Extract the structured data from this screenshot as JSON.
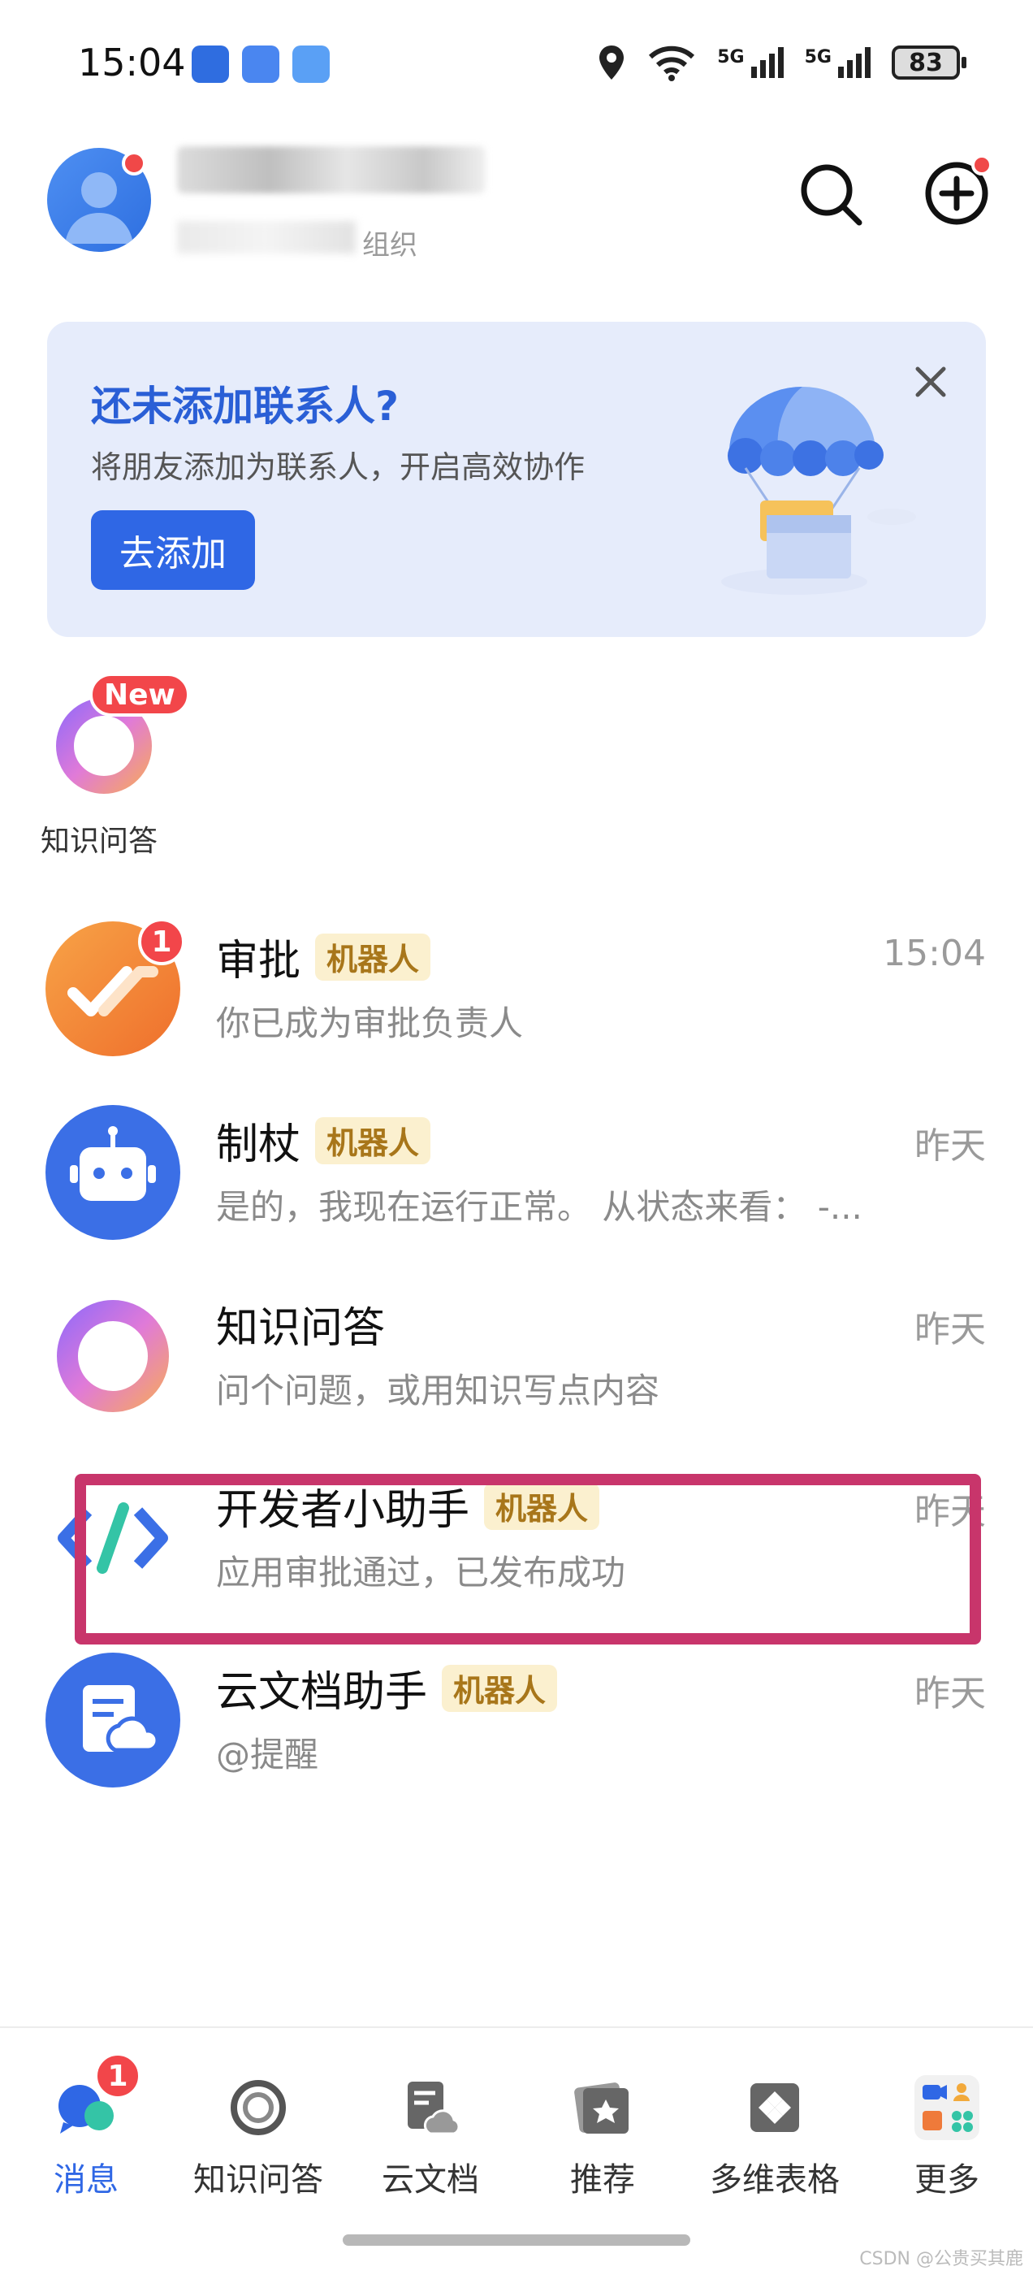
{
  "status_bar": {
    "time": "15:04",
    "net1": "5G",
    "net2": "5G",
    "battery": "83"
  },
  "header": {
    "org_suffix": "组织"
  },
  "banner": {
    "title": "还未添加联系人?",
    "subtitle": "将朋友添加为联系人，开启高效协作",
    "button": "去添加"
  },
  "quick_app": {
    "badge": "New",
    "label": "知识问答"
  },
  "chats": [
    {
      "name": "审批",
      "tag": "机器人",
      "time": "15:04",
      "preview": "你已成为审批负责人",
      "badge": "1"
    },
    {
      "name": "制杖",
      "tag": "机器人",
      "time": "昨天",
      "preview": "是的，我现在运行正常。 从状态来看： -..."
    },
    {
      "name": "知识问答",
      "tag": "",
      "time": "昨天",
      "preview": "问个问题，或用知识写点内容"
    },
    {
      "name": "开发者小助手",
      "tag": "机器人",
      "time": "昨天",
      "preview": "应用审批通过，已发布成功"
    },
    {
      "name": "云文档助手",
      "tag": "机器人",
      "time": "昨天",
      "preview": "@提醒"
    }
  ],
  "bottom_nav": [
    {
      "label": "消息",
      "badge": "1",
      "active": true
    },
    {
      "label": "知识问答"
    },
    {
      "label": "云文档"
    },
    {
      "label": "推荐"
    },
    {
      "label": "多维表格"
    },
    {
      "label": "更多"
    }
  ],
  "watermark": "CSDN @公贵买其鹿",
  "colors": {
    "accent": "#2f67e5",
    "badge": "#f2464a",
    "bot_tag_bg": "#fbf0cf",
    "bot_tag_text": "#a8761a",
    "highlight": "#c8356b"
  }
}
